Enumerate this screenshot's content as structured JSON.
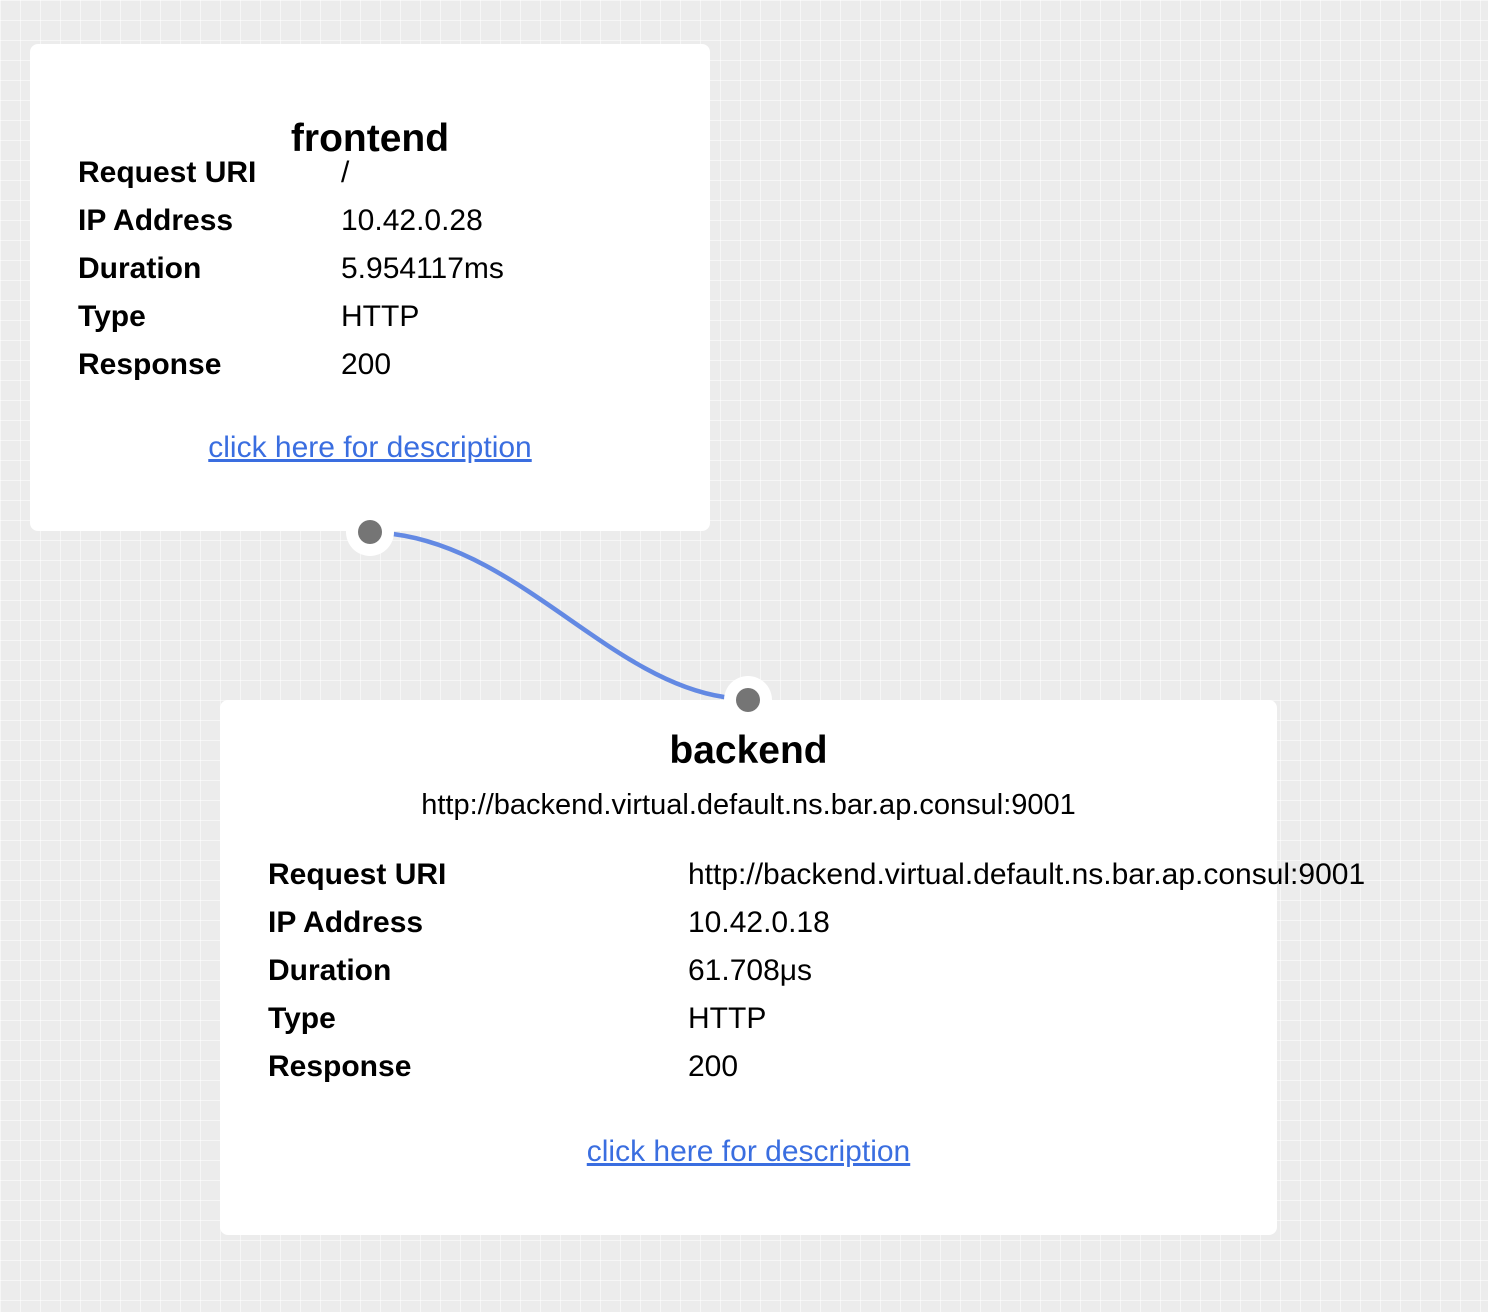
{
  "edge": {
    "color": "#6389e3"
  },
  "nodes": {
    "frontend": {
      "title": "frontend",
      "details": [
        {
          "key": "Request URI",
          "value": "/"
        },
        {
          "key": "IP Address",
          "value": "10.42.0.28"
        },
        {
          "key": "Duration",
          "value": "5.954117ms"
        },
        {
          "key": "Type",
          "value": "HTTP"
        },
        {
          "key": "Response",
          "value": "200"
        }
      ],
      "link": "click here for description"
    },
    "backend": {
      "title": "backend",
      "subtitle": "http://backend.virtual.default.ns.bar.ap.consul:9001",
      "details": [
        {
          "key": "Request URI",
          "value": "http://backend.virtual.default.ns.bar.ap.consul:9001"
        },
        {
          "key": "IP Address",
          "value": "10.42.0.18"
        },
        {
          "key": "Duration",
          "value": "61.708μs"
        },
        {
          "key": "Type",
          "value": "HTTP"
        },
        {
          "key": "Response",
          "value": "200"
        }
      ],
      "link": "click here for description"
    }
  },
  "colors": {
    "link": "#3a6ee0",
    "port_dot": "#757575",
    "background": "#ececec"
  }
}
